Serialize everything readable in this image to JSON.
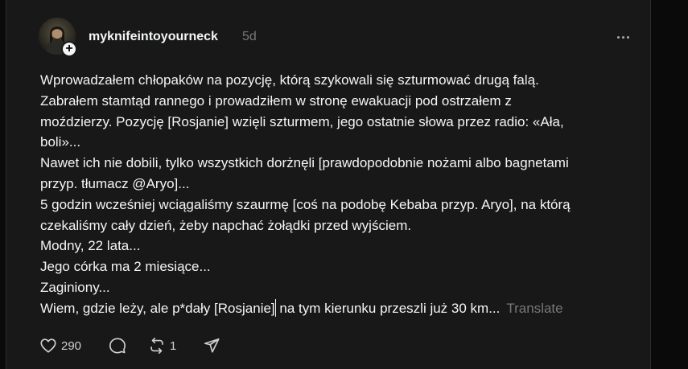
{
  "post": {
    "username": "myknifeintoyourneck",
    "timestamp": "5d",
    "lines": [
      "Wprowadzałem chłopaków na pozycję, którą szykowali się szturmować drugą falą.",
      "Zabrałem stamtąd rannego i prowadziłem w stronę ewakuacji pod ostrzałem z",
      "moździerzy. Pozycję [Rosjanie] wzięli szturmem, jego ostatnie słowa przez radio: «Ała,",
      "boli»...",
      "Nawet ich nie dobili, tylko wszystkich dorżnęli [prawdopodobnie nożami albo bagnetami",
      "przyp. tłumacz @Aryo]...",
      "5 godzin wcześniej wciągaliśmy szaurmę [coś na podobę Kebaba przyp. Aryo], na którą",
      "czekaliśmy cały dzień, żeby napchać żołądki przed wyjściem.",
      "Modny, 22 lata...",
      "Jego córka ma 2 miesiące...",
      "Zaginiony..."
    ],
    "last_line_before_caret": "Wiem, gdzie leży, ale p*dały [Rosjanie]",
    "last_line_after_caret": " na tym kierunku przeszli już 30 km...",
    "translate_label": "Translate",
    "follow_symbol": "+",
    "actions": {
      "like_count": "290",
      "repost_count": "1"
    }
  },
  "icons": {
    "like": "heart-icon",
    "comment": "comment-bubble-icon",
    "repost": "repost-icon",
    "share": "send-icon",
    "more": "more-horizontal-icon"
  },
  "colors": {
    "background": "#181818",
    "text": "#f3f5f7",
    "muted": "#777777"
  }
}
